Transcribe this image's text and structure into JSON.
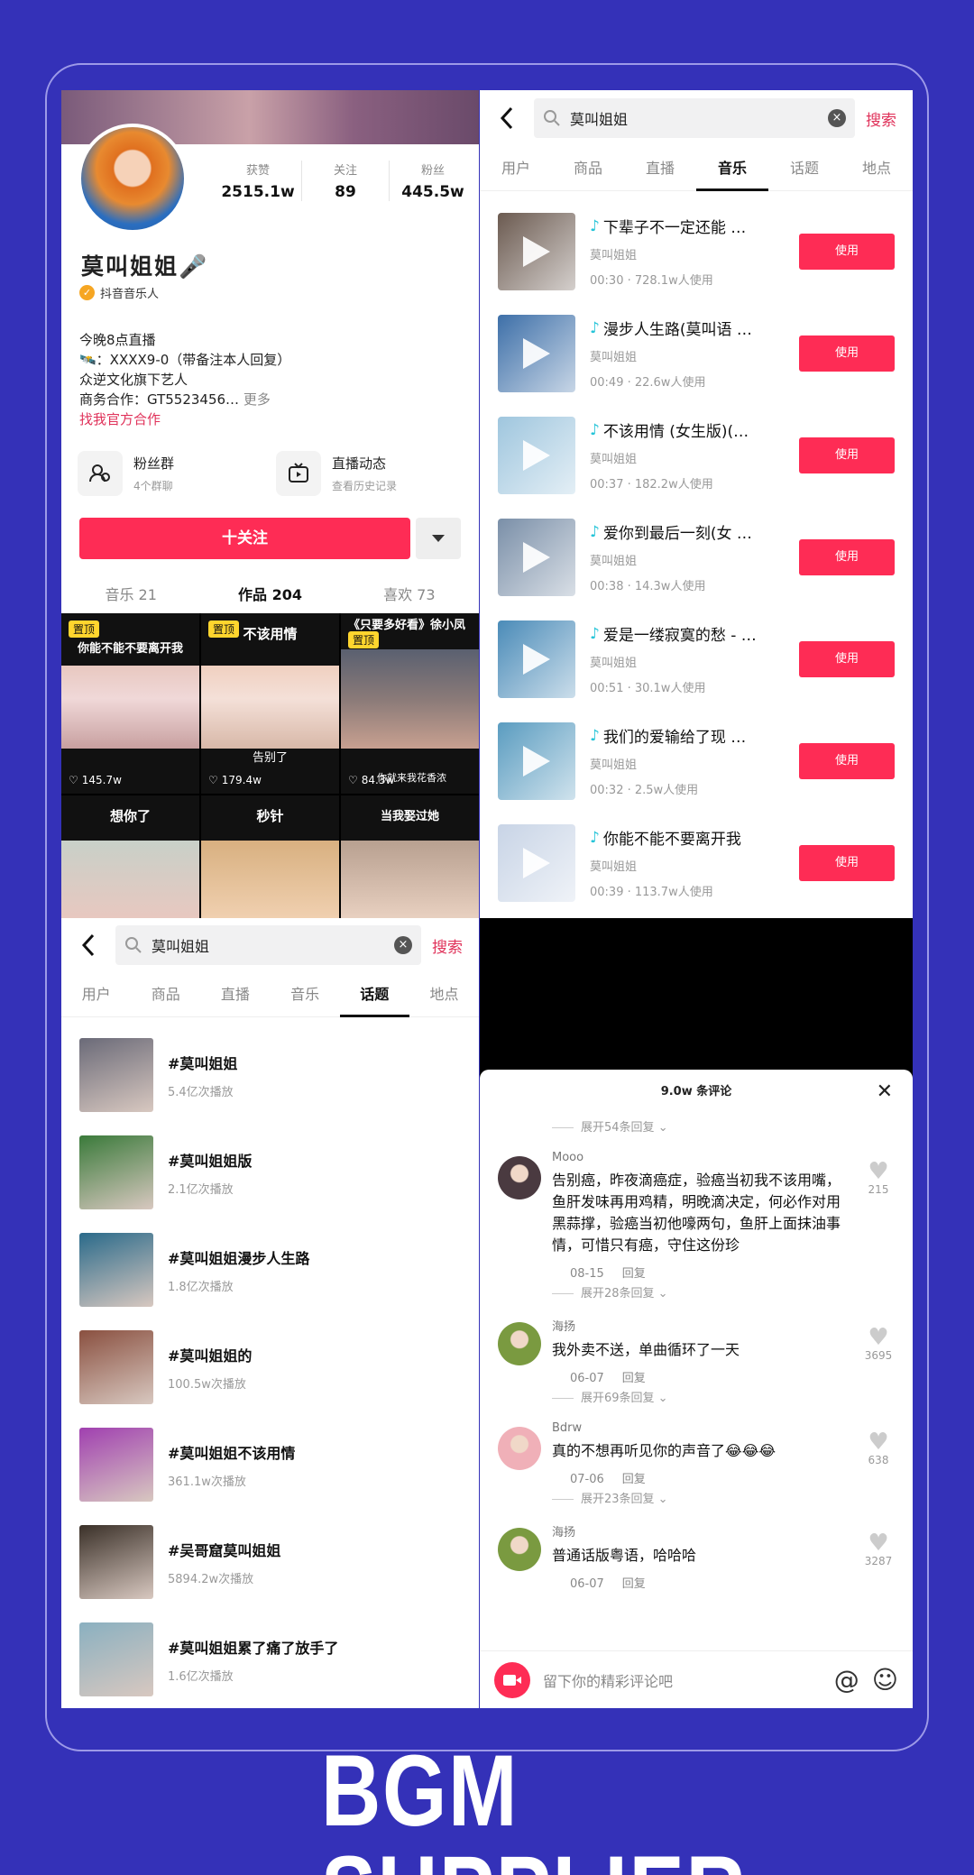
{
  "profile": {
    "stats": [
      {
        "label": "获赞",
        "value": "2515.1w"
      },
      {
        "label": "关注",
        "value": "89"
      },
      {
        "label": "粉丝",
        "value": "445.5w"
      }
    ],
    "name": "莫叫姐姐🎤",
    "badge": "抖音音乐人",
    "bio": {
      "line1": "今晚8点直播",
      "line2": "🛰️：XXXX9-0（带备注本人回复）",
      "line3": "众逆文化旗下艺人",
      "line4": "商务合作：GT5523456…",
      "more": "更多",
      "link": "找我官方合作"
    },
    "cards": [
      {
        "title": "粉丝群",
        "sub": "4个群聊"
      },
      {
        "title": "直播动态",
        "sub": "查看历史记录"
      }
    ],
    "follow_label": "十关注",
    "tabs": [
      "音乐 21",
      "作品 204",
      "喜欢 73"
    ],
    "videos": [
      {
        "caption": "你能不能不要离开我",
        "pin": "置顶",
        "likes": "145.7w",
        "sub": ""
      },
      {
        "caption": "不该用情",
        "pin": "置顶",
        "likes": "179.4w",
        "sub": "告别了"
      },
      {
        "caption": "《只要多好看》徐小凤",
        "pin": "置顶",
        "likes": "84.3w",
        "sub": "你就来我花香浓"
      },
      {
        "caption": "想你了",
        "pin": "",
        "likes": "",
        "sub": ""
      },
      {
        "caption": "秒针",
        "pin": "",
        "likes": "",
        "sub": ""
      },
      {
        "caption": "当我娶过她",
        "pin": "",
        "likes": "",
        "sub": ""
      }
    ]
  },
  "search_music": {
    "query": "莫叫姐姐",
    "search_label": "搜索",
    "tabs": [
      "用户",
      "商品",
      "直播",
      "音乐",
      "话题",
      "地点"
    ],
    "active_tab": "音乐",
    "use_label": "使用",
    "songs": [
      {
        "title": "下辈子不一定还能 …",
        "artist": "莫叫姐姐",
        "meta": "00:30 · 728.1w人使用",
        "color": "#6b5a50"
      },
      {
        "title": "漫步人生路(莫叫语 …",
        "artist": "莫叫姐姐",
        "meta": "00:49 · 22.6w人使用",
        "color": "#3d6fa8"
      },
      {
        "title": "不该用情 (女生版)(…",
        "artist": "莫叫姐姐",
        "meta": "00:37 · 182.2w人使用",
        "color": "#9fc6de"
      },
      {
        "title": "爱你到最后一刻(女 …",
        "artist": "莫叫姐姐",
        "meta": "00:38 · 14.3w人使用",
        "color": "#7a8fa8"
      },
      {
        "title": "爱是一缕寂寞的愁 - …",
        "artist": "莫叫姐姐",
        "meta": "00:51 · 30.1w人使用",
        "color": "#4a8bb8"
      },
      {
        "title": "我们的爱输给了现 …",
        "artist": "莫叫姐姐",
        "meta": "00:32 · 2.5w人使用",
        "color": "#5a9cc0"
      },
      {
        "title": "你能不能不要离开我",
        "artist": "莫叫姐姐",
        "meta": "00:39 · 113.7w人使用",
        "color": "#c8d4e6"
      }
    ]
  },
  "search_topics": {
    "query": "莫叫姐姐",
    "search_label": "搜索",
    "tabs": [
      "用户",
      "商品",
      "直播",
      "音乐",
      "话题",
      "地点"
    ],
    "active_tab": "话题",
    "topics": [
      {
        "title": "#莫叫姐姐",
        "plays": "5.4亿次播放",
        "color": "#6a6a78"
      },
      {
        "title": "#莫叫姐姐版",
        "plays": "2.1亿次播放",
        "color": "#3a7a3a"
      },
      {
        "title": "#莫叫姐姐漫步人生路",
        "plays": "1.8亿次播放",
        "color": "#2a6a8a"
      },
      {
        "title": "#莫叫姐姐的",
        "plays": "100.5w次播放",
        "color": "#8a5040"
      },
      {
        "title": "#莫叫姐姐不该用情",
        "plays": "361.1w次播放",
        "color": "#a040b0"
      },
      {
        "title": "#吴哥窟莫叫姐姐",
        "plays": "5894.2w次播放",
        "color": "#3a3028"
      },
      {
        "title": "#莫叫姐姐累了痛了放手了",
        "plays": "1.6亿次播放",
        "color": "#8ab0c0"
      }
    ]
  },
  "comments": {
    "title": "9.0w 条评论",
    "expand_top": "展开54条回复",
    "items": [
      {
        "user": "Mooo",
        "text": "告别癌，昨夜滴癌症，验癌当初我不该用嘴，鱼肝发味再用鸡精，明晚滴决定，何必作对用黑蒜撑，验癌当初他嚎两句，鱼肝上面抹油事情，可惜只有癌，守住这份珍",
        "date": "08-15",
        "reply": "回复",
        "likes": "215",
        "expand": "展开28条回复",
        "color": "#4a3a40"
      },
      {
        "user": "海扬",
        "text": "我外卖不送，单曲循环了一天",
        "date": "06-07",
        "reply": "回复",
        "likes": "3695",
        "expand": "展开69条回复",
        "color": "#7a9a40"
      },
      {
        "user": "Bdrw",
        "text": "真的不想再听见你的声音了😂😂😂",
        "date": "07-06",
        "reply": "回复",
        "likes": "638",
        "expand": "展开23条回复",
        "color": "#f0b0b8"
      },
      {
        "user": "海扬",
        "text": "普通话版粤语，哈哈哈",
        "date": "06-07",
        "reply": "回复",
        "likes": "3287",
        "expand": "",
        "color": "#7a9a40"
      }
    ],
    "input_placeholder": "留下你的精彩评论吧",
    "at_symbol": "@",
    "emoji_symbol": "☺"
  },
  "brand_text": "BGM SUPPLIER"
}
